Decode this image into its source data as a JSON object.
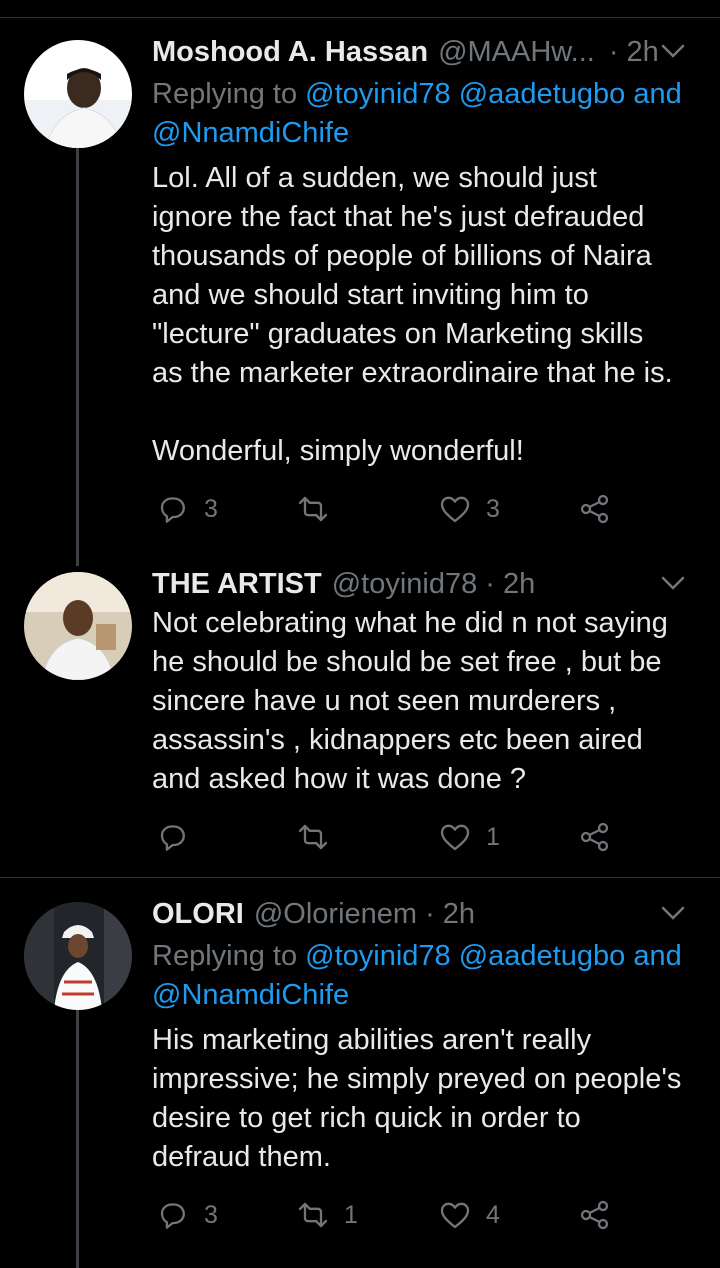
{
  "tweets": [
    {
      "name": "Moshood A. Hassan",
      "handle": "@MAAHw...",
      "time": "· 2h",
      "reply_prefix": "Replying to ",
      "reply_mentions": "@toyinid78 @aadetugbo and",
      "reply_mentions2": "@NnamdiChife",
      "text": "Lol. All of a sudden, we should just\nignore the fact that he's just defrauded\nthousands of people of billions of Naira\nand we should start inviting him to\n\"lecture\" graduates on Marketing skills\nas the marketer extraordinaire that he is.\n\nWonderful, simply wonderful!",
      "replies": "3",
      "retweets": "",
      "likes": "3"
    },
    {
      "name": "THE ARTIST",
      "handle": "@toyinid78",
      "time": "· 2h",
      "text": "Not celebrating what he did n not saying\nhe should be should be set free , but be\nsincere have u not seen murderers ,\nassassin's , kidnappers etc been aired\nand asked how it was done ?",
      "replies": "",
      "retweets": "",
      "likes": "1"
    },
    {
      "name": "OLORI",
      "handle": "@Olorienem",
      "time": "· 2h",
      "reply_prefix": "Replying to ",
      "reply_mentions": "@toyinid78 @aadetugbo and",
      "reply_mentions2": "@NnamdiChife",
      "text": "His marketing abilities aren't really\nimpressive; he simply preyed on people's\ndesire to get rich quick in order to\ndefraud them.",
      "replies": "3",
      "retweets": "1",
      "likes": "4"
    }
  ],
  "colors": {
    "background": "#000000",
    "name": "#e7e9ea",
    "muted": "#71767b",
    "link": "#1d9bf0"
  },
  "icons": [
    "reply-icon",
    "retweet-icon",
    "like-icon",
    "share-icon",
    "chevron-down-icon"
  ]
}
